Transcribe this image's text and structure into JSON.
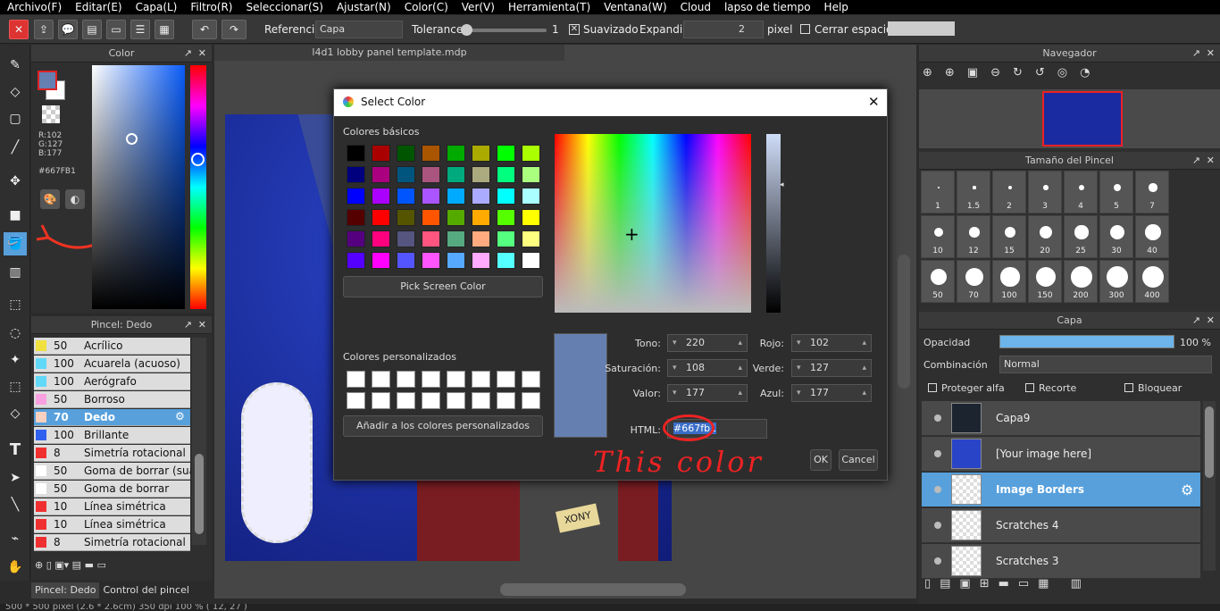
{
  "menu": [
    "Archivo(F)",
    "Editar(E)",
    "Capa(L)",
    "Filtro(R)",
    "Seleccionar(S)",
    "Ajustar(N)",
    "Color(C)",
    "Ver(V)",
    "Herramienta(T)",
    "Ventana(W)",
    "Cloud",
    "lapso de tiempo",
    "Help"
  ],
  "toolbar": {
    "referencia_label": "Referencia",
    "referencia_value": "Capa",
    "tolerance_label": "Tolerance",
    "tolerance_value": "1",
    "suavizado_label": "Suavizado",
    "expandir_label": "Expandir",
    "expandir_value": "2",
    "pixel_label": "pixel",
    "cerrar_label": "Cerrar espacios"
  },
  "color_panel": {
    "title": "Color",
    "r": "R:102",
    "g": "G:127",
    "b": "B:177",
    "hex": "#667FB1",
    "fg_color": "#667fb1"
  },
  "brush_panel": {
    "title": "Pincel: Dedo",
    "tabs": [
      "Pincel: Dedo",
      "Control del pincel"
    ],
    "items": [
      {
        "size": "50",
        "name": "Acrílico",
        "color": "#f0e040"
      },
      {
        "size": "100",
        "name": "Acuarela (acuoso)",
        "color": "#60d8f8"
      },
      {
        "size": "100",
        "name": "Aerógrafo",
        "color": "#60d8f8"
      },
      {
        "size": "50",
        "name": "Borroso",
        "color": "#f8a0e0"
      },
      {
        "size": "70",
        "name": "Dedo",
        "color": "#f8d0c0",
        "active": true
      },
      {
        "size": "100",
        "name": "Brillante",
        "color": "#3060f0"
      },
      {
        "size": "8",
        "name": "Simetría rotacional",
        "color": "#f03030"
      },
      {
        "size": "50",
        "name": "Goma de borrar (suave)",
        "color": "#ffffff"
      },
      {
        "size": "50",
        "name": "Goma de borrar",
        "color": "#ffffff"
      },
      {
        "size": "10",
        "name": "Línea simétrica",
        "color": "#f03030"
      },
      {
        "size": "10",
        "name": "Línea simétrica",
        "color": "#f03030"
      },
      {
        "size": "8",
        "name": "Simetría rotacional",
        "color": "#f03030"
      }
    ]
  },
  "document": {
    "tab": "l4d1 lobby panel template.mdp"
  },
  "navigator": {
    "title": "Navegador"
  },
  "brush_size": {
    "title": "Tamaño del Pincel",
    "sizes": [
      "1",
      "1.5",
      "2",
      "3",
      "4",
      "5",
      "7",
      "10",
      "12",
      "15",
      "20",
      "25",
      "30",
      "40",
      "50",
      "70",
      "100",
      "150",
      "200",
      "300",
      "400"
    ]
  },
  "layer_panel": {
    "title": "Capa",
    "opacity_label": "Opacidad",
    "opacity_value": "100 %",
    "opacity_fraction": 1.0,
    "blend_label": "Combinación",
    "blend_value": "Normal",
    "protect_label": "Proteger alfa",
    "clip_label": "Recorte",
    "lock_label": "Bloquear",
    "layers": [
      {
        "name": "Capa9"
      },
      {
        "name": "[Your image here]"
      },
      {
        "name": "Image Borders",
        "active": true
      },
      {
        "name": "Scratches 4"
      },
      {
        "name": "Scratches 3"
      }
    ]
  },
  "dialog": {
    "title": "Select Color",
    "basic_label": "Colores básicos",
    "pick_label": "Pick Screen Color",
    "custom_label": "Colores personalizados",
    "add_label": "Añadir a los colores personalizados",
    "basic_colors": [
      "#000000",
      "#aa0000",
      "#005500",
      "#aa5500",
      "#00aa00",
      "#aaaa00",
      "#00ff00",
      "#aaff00",
      "#00007f",
      "#aa007f",
      "#00557f",
      "#aa557f",
      "#00aa7f",
      "#aaaa7f",
      "#00ff7f",
      "#aaff7f",
      "#0000ff",
      "#aa00ff",
      "#0055ff",
      "#aa55ff",
      "#00aaff",
      "#aaaaff",
      "#00ffff",
      "#aaffff",
      "#550000",
      "#ff0000",
      "#555500",
      "#ff5500",
      "#55aa00",
      "#ffaa00",
      "#55ff00",
      "#ffff00",
      "#55007f",
      "#ff007f",
      "#55557f",
      "#ff557f",
      "#55aa7f",
      "#ffaa7f",
      "#55ff7f",
      "#ffff7f",
      "#5500ff",
      "#ff00ff",
      "#5555ff",
      "#ff55ff",
      "#55aaff",
      "#ffaaff",
      "#55ffff",
      "#ffffff"
    ],
    "tono_label": "Tono:",
    "tono": "220",
    "sat_label": "Saturación:",
    "sat": "108",
    "valor_label": "Valor:",
    "valor": "177",
    "rojo_label": "Rojo:",
    "rojo": "102",
    "verde_label": "Verde:",
    "verde": "127",
    "azul_label": "Azul:",
    "azul": "177",
    "html_label": "HTML:",
    "html_value": "#667fb1",
    "ok": "OK",
    "cancel": "Cancel"
  },
  "annotation": {
    "text": "This color"
  },
  "status": "500 * 500 pixel  (2.6 * 2.6cm)  350 dpi  100 %  ( 12, 27 )"
}
